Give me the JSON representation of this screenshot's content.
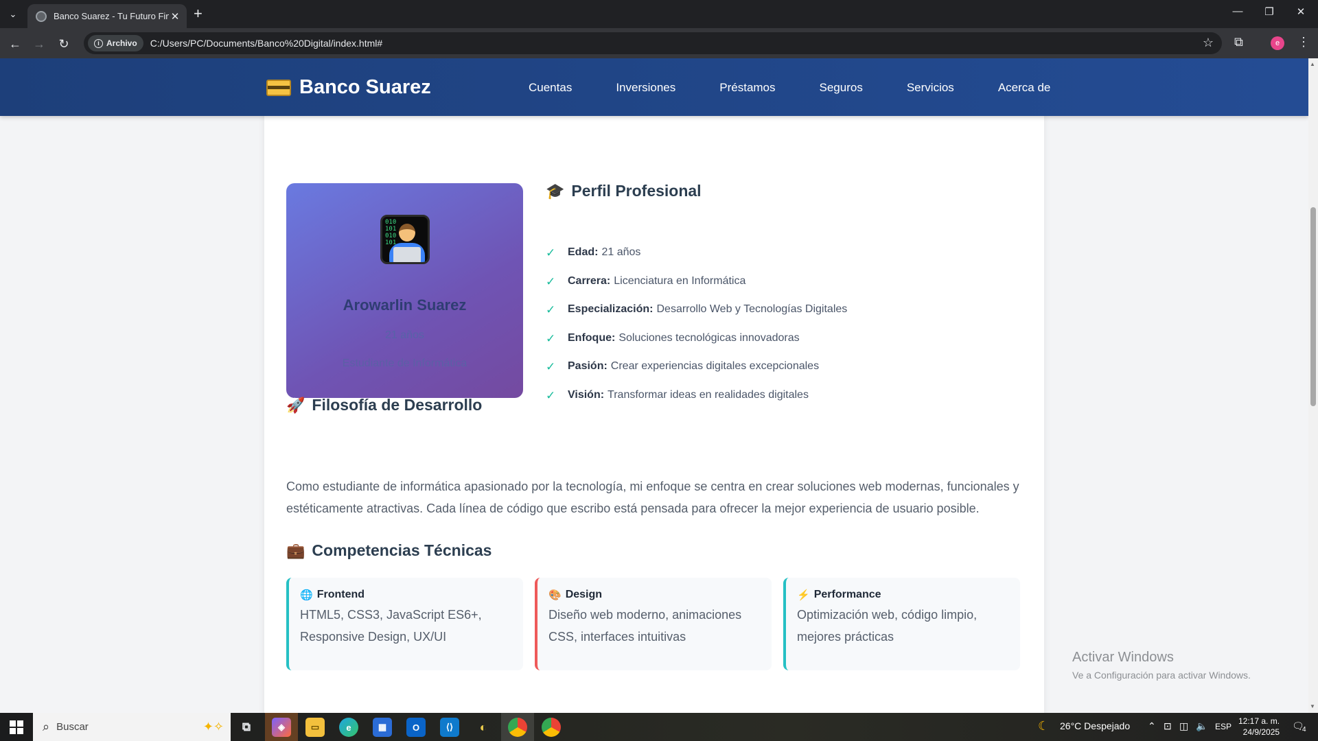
{
  "browser": {
    "tab_title": "Banco Suarez - Tu Futuro Finan",
    "site_chip": "Archivo",
    "url": "C:/Users/PC/Documents/Banco%20Digital/index.html#",
    "profile_initial": "e"
  },
  "site": {
    "brand": "Banco Suarez",
    "nav": [
      "Cuentas",
      "Inversiones",
      "Préstamos",
      "Seguros",
      "Servicios",
      "Acerca de"
    ]
  },
  "profile_card": {
    "name": "Arowarlin Suarez",
    "age": "21 años",
    "role": "Estudiante de Informática",
    "avatar_code": "010\n101\n010\n101"
  },
  "perfil": {
    "title": "Perfil Profesional",
    "icon": "graduation-cap-icon",
    "items": [
      {
        "label": "Edad:",
        "value": "21 años"
      },
      {
        "label": "Carrera:",
        "value": "Licenciatura en Informática"
      },
      {
        "label": "Especialización:",
        "value": "Desarrollo Web y Tecnologías Digitales"
      },
      {
        "label": "Enfoque:",
        "value": "Soluciones tecnológicas innovadoras"
      },
      {
        "label": "Pasión:",
        "value": "Crear experiencias digitales excepcionales"
      },
      {
        "label": "Visión:",
        "value": "Transformar ideas en realidades digitales"
      }
    ]
  },
  "filosofia": {
    "title": "Filosofía de Desarrollo",
    "icon": "rocket-icon",
    "text": "Como estudiante de informática apasionado por la tecnología, mi enfoque se centra en crear soluciones web modernas, funcionales y estéticamente atractivas. Cada línea de código que escribo está pensada para ofrecer la mejor experiencia de usuario posible."
  },
  "competencias": {
    "title": "Competencias Técnicas",
    "icon": "briefcase-icon",
    "skills": [
      {
        "title": "Frontend",
        "desc": "HTML5, CSS3, JavaScript ES6+, Responsive Design, UX/UI",
        "color": "#25c0c4"
      },
      {
        "title": "Design",
        "desc": "Diseño web moderno, animaciones CSS, interfaces intuitivas",
        "color": "#ee5a5a"
      },
      {
        "title": "Performance",
        "desc": "Optimización web, código limpio, mejores prácticas",
        "color": "#25c0c4"
      }
    ]
  },
  "watermark": {
    "line1": "Activar Windows",
    "line2": "Ve a Configuración para activar Windows."
  },
  "taskbar": {
    "search_placeholder": "Buscar",
    "weather": "26°C  Despejado",
    "lang": "ESP",
    "time": "12:17 a. m.",
    "date": "24/9/2025",
    "notifications": "4"
  }
}
